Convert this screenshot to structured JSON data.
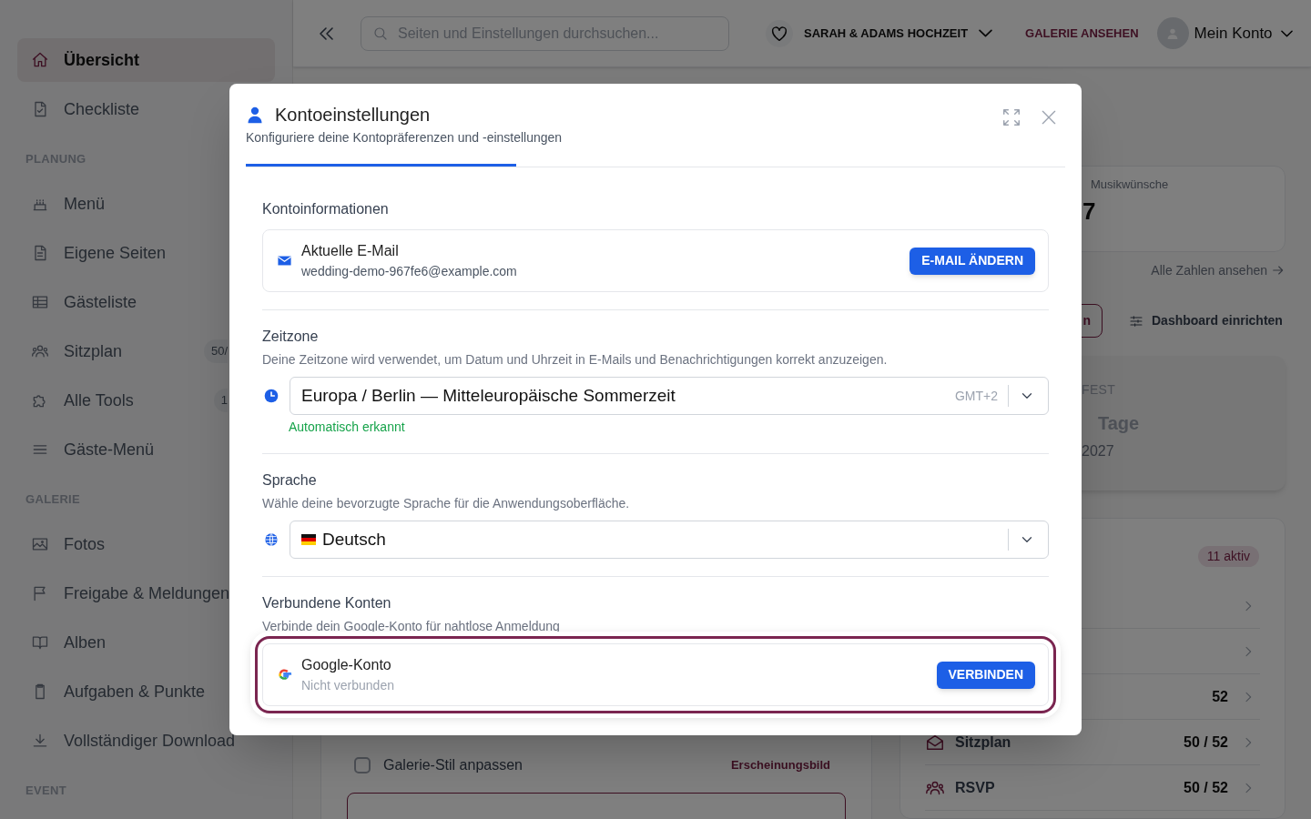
{
  "sidebar": {
    "groups": [
      {
        "items": [
          {
            "label": "Übersicht",
            "selected": true
          },
          {
            "label": "Checkliste",
            "selected": false
          }
        ]
      },
      {
        "heading": "PLANUNG",
        "items": [
          {
            "label": "Menü",
            "selected": false
          },
          {
            "label": "Eigene Seiten",
            "selected": false
          },
          {
            "label": "Gästeliste",
            "selected": false
          },
          {
            "label": "Sitzplan",
            "selected": false,
            "badge": "50/"
          },
          {
            "label": "Alle Tools",
            "selected": false,
            "badge": "1"
          },
          {
            "label": "Gäste-Menü",
            "selected": false
          }
        ]
      },
      {
        "heading": "GALERIE",
        "items": [
          {
            "label": "Fotos",
            "selected": false
          },
          {
            "label": "Freigabe & Meldungen",
            "selected": false
          },
          {
            "label": "Alben",
            "selected": false
          },
          {
            "label": "Aufgaben & Punkte",
            "selected": false
          },
          {
            "label": "Vollständiger Download",
            "selected": false
          }
        ]
      },
      {
        "heading": "EVENT"
      }
    ]
  },
  "header": {
    "search": {
      "placeholder": "Seiten und Einstellungen durchsuchen..."
    },
    "event": "SARAH & ADAMS HOCHZEIT",
    "gallery_link": "GALERIE ANSEHEN",
    "account": "Mein Konto"
  },
  "dashboard": {
    "stat": {
      "value": "7",
      "label": "Musikwünsche"
    },
    "all_numbers_link": "Alle Zahlen ansehen",
    "partial_button": "n",
    "setup_button": "Dashboard einrichten",
    "countdown": {
      "label": "FEST",
      "unit": "Tage",
      "date": "2027"
    },
    "tools": {
      "badge": "11 aktiv",
      "rows": [
        {},
        {},
        {
          "value": "52"
        },
        {
          "label": "Sitzplan",
          "value": "50 / 52"
        },
        {
          "label": "RSVP",
          "value": "50 / 52"
        }
      ]
    },
    "checklist": [
      {
        "label": "Galerie-Stil anpassen",
        "checked": false,
        "category": "Erscheinungsbild"
      }
    ]
  },
  "modal": {
    "title": "Kontoeinstellungen",
    "subtitle": "Konfiguriere deine Kontopräferenzen und -einstellungen",
    "sections": [
      {
        "kind": "email",
        "heading": "Kontoinformationen",
        "label": "Aktuelle E-Mail",
        "value": "wedding-demo-967fe6@example.com",
        "button": "E-MAIL ÄNDERN"
      },
      {
        "kind": "timezone",
        "heading": "Zeitzone",
        "description": "Deine Zeitzone wird verwendet, um Datum und Uhrzeit in E-Mails und Benachrichtigungen korrekt anzuzeigen.",
        "value": "Europa / Berlin — Mitteleuropäische Sommerzeit",
        "hint": "GMT+2",
        "note": "Automatisch erkannt"
      },
      {
        "kind": "language",
        "heading": "Sprache",
        "description": "Wähle deine bevorzugte Sprache für die Anwendungsoberfläche.",
        "value": "Deutsch"
      },
      {
        "kind": "accounts",
        "heading": "Verbundene Konten",
        "description": "Verbinde dein Google-Konto für nahtlose Anmeldung",
        "label": "Google-Konto",
        "status": "Nicht verbunden",
        "button": "VERBINDEN",
        "highlighted": true
      }
    ]
  }
}
